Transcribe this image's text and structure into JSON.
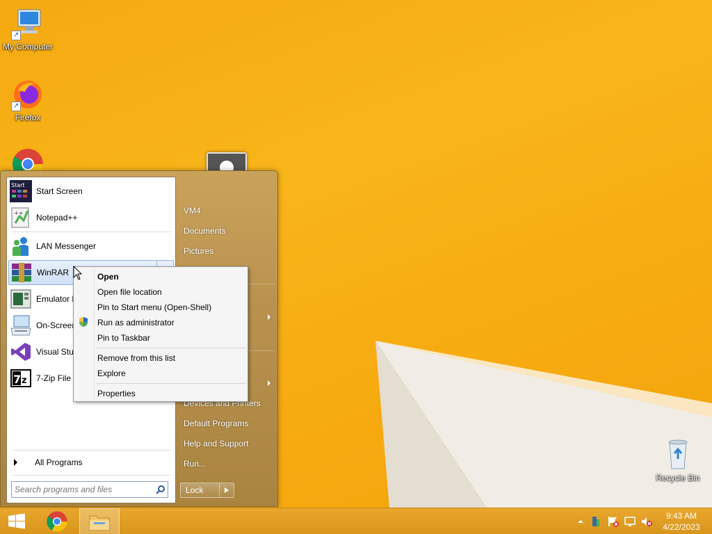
{
  "desktop": {
    "icons": [
      {
        "label": "My Computer",
        "icon": "computer-icon"
      },
      {
        "label": "Firefox",
        "icon": "firefox-icon"
      },
      {
        "label": "",
        "icon": "chrome-icon"
      },
      {
        "label": "Recycle Bin",
        "icon": "recycle-bin-icon"
      }
    ]
  },
  "start_menu": {
    "pinned": [
      {
        "label": "Start Screen",
        "icon": "start-screen-icon"
      },
      {
        "label": "Notepad++",
        "icon": "notepadpp-icon"
      }
    ],
    "recent": [
      {
        "label": "LAN Messenger",
        "icon": "lan-messenger-icon"
      },
      {
        "label": "WinRAR",
        "icon": "winrar-icon"
      },
      {
        "label": "Emulator B",
        "icon": "emulator-icon"
      },
      {
        "label": "On-Screen",
        "icon": "keyboard-icon"
      },
      {
        "label": "Visual Stud",
        "icon": "visual-studio-icon"
      },
      {
        "label": "7-Zip File N",
        "icon": "7zip-icon"
      }
    ],
    "all_programs": "All Programs",
    "search_placeholder": "Search programs and files",
    "right_items": [
      "VM4",
      "Documents",
      "Pictures",
      "Devices and Printers",
      "Default Programs",
      "Help and Support",
      "Run..."
    ],
    "lock_label": "Lock"
  },
  "context_menu": {
    "items": [
      {
        "label": "Open",
        "bold": true
      },
      {
        "label": "Open file location"
      },
      {
        "label": "Pin to Start menu (Open-Shell)"
      },
      {
        "label": "Run as administrator",
        "icon": "uac-shield-icon"
      },
      {
        "label": "Pin to Taskbar"
      },
      {
        "label": "Remove from this list"
      },
      {
        "label": "Explore"
      },
      {
        "label": "Properties"
      }
    ]
  },
  "taskbar": {
    "start_button": "windows-logo-icon",
    "pinned": [
      "chrome-icon",
      "file-explorer-icon"
    ],
    "tray_icons": [
      "show-hidden-icons",
      "network-icon",
      "action-center-icon",
      "display-icon",
      "volume-muted-icon"
    ],
    "time": "9:43 AM",
    "date": "4/22/2023"
  },
  "colors": {
    "wallpaper": "#f7ad12",
    "start_menu_frame": "#b7904d",
    "highlight": "#cfe0f7"
  }
}
